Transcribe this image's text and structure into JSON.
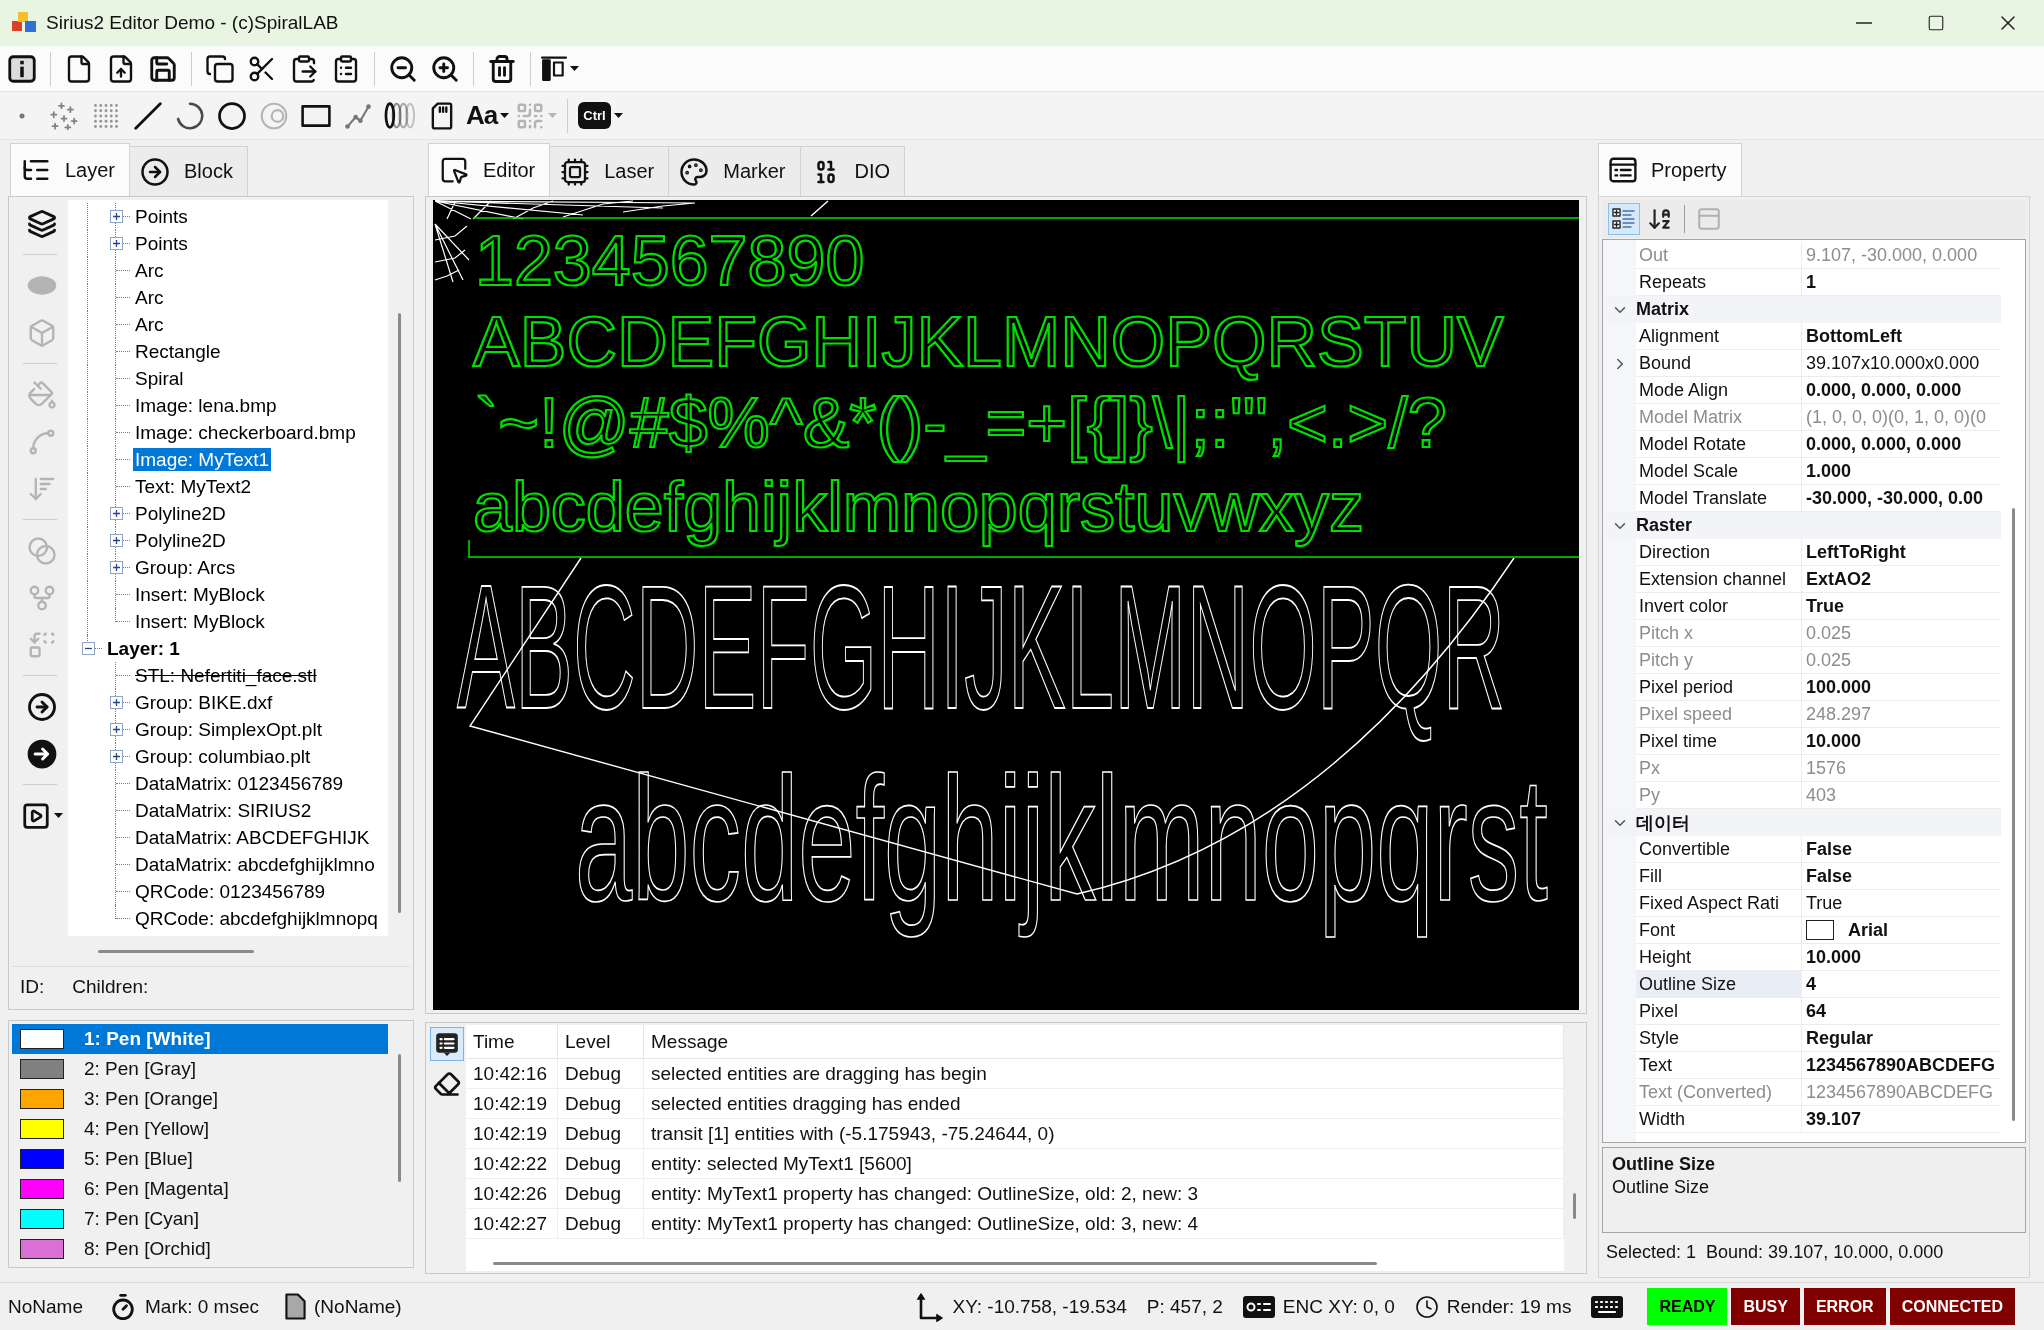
{
  "window": {
    "title": "Sirius2 Editor Demo - (c)SpiralLAB"
  },
  "main_toolbar": {
    "groups": [
      {
        "buttons": [
          {
            "kind": "info",
            "disabled": false,
            "menu": false
          }
        ]
      },
      {
        "buttons": [
          {
            "kind": "new",
            "disabled": false,
            "menu": false
          },
          {
            "kind": "open",
            "disabled": false,
            "menu": false
          },
          {
            "kind": "save",
            "disabled": false,
            "menu": false
          }
        ]
      },
      {
        "buttons": [
          {
            "kind": "copy",
            "disabled": false,
            "menu": false
          },
          {
            "kind": "cut",
            "disabled": false,
            "menu": false
          },
          {
            "kind": "paste",
            "disabled": false,
            "menu": false
          },
          {
            "kind": "clipboard",
            "disabled": false,
            "menu": false
          }
        ]
      },
      {
        "buttons": [
          {
            "kind": "zoomout",
            "disabled": false,
            "menu": false
          },
          {
            "kind": "zoomin",
            "disabled": false,
            "menu": false
          }
        ]
      },
      {
        "buttons": [
          {
            "kind": "delete",
            "disabled": false,
            "menu": false
          }
        ]
      },
      {
        "buttons": [
          {
            "kind": "align",
            "disabled": false,
            "menu": true
          }
        ]
      }
    ]
  },
  "draw_toolbar": {
    "groups": [
      {
        "buttons": [
          {
            "kind": "point",
            "disabled": false,
            "menu": false
          },
          {
            "kind": "points",
            "disabled": false,
            "menu": false
          },
          {
            "kind": "grid",
            "disabled": false,
            "menu": false
          },
          {
            "kind": "line",
            "disabled": false,
            "menu": false
          },
          {
            "kind": "arc",
            "disabled": false,
            "menu": false
          },
          {
            "kind": "circle",
            "disabled": false,
            "menu": false
          },
          {
            "kind": "trepan",
            "disabled": true,
            "menu": false
          },
          {
            "kind": "rectangle",
            "disabled": false,
            "menu": false
          },
          {
            "kind": "polyline",
            "disabled": false,
            "menu": false
          },
          {
            "kind": "spiral",
            "disabled": false,
            "menu": false
          },
          {
            "kind": "card",
            "disabled": false,
            "menu": false
          },
          {
            "kind": "text",
            "label": "Aa",
            "disabled": false,
            "menu": true
          },
          {
            "kind": "barcode",
            "disabled": true,
            "menu": true
          }
        ]
      },
      {
        "buttons": [
          {
            "kind": "key",
            "label": "Ctrl",
            "disabled": false,
            "menu": true
          }
        ]
      }
    ]
  },
  "left_tabs": [
    {
      "label": "Layer",
      "kind": "tree",
      "selected": true
    },
    {
      "label": "Block",
      "kind": "block",
      "selected": false
    }
  ],
  "side_tools": {
    "groups": [
      {
        "buttons": [
          {
            "kind": "layers",
            "disabled": false,
            "menu": false
          }
        ]
      },
      {
        "buttons": [
          {
            "kind": "mesh",
            "disabled": true,
            "menu": false
          },
          {
            "kind": "cube",
            "disabled": true,
            "menu": false
          }
        ]
      },
      {
        "buttons": [
          {
            "kind": "bucket",
            "disabled": true,
            "menu": false
          },
          {
            "kind": "path",
            "disabled": true,
            "menu": false
          },
          {
            "kind": "sort",
            "disabled": true,
            "menu": false
          }
        ]
      },
      {
        "buttons": [
          {
            "kind": "union",
            "disabled": true,
            "menu": false
          },
          {
            "kind": "split",
            "disabled": true,
            "menu": false
          },
          {
            "kind": "swap",
            "disabled": true,
            "menu": false
          }
        ]
      },
      {
        "buttons": [
          {
            "kind": "block",
            "disabled": false,
            "menu": false
          },
          {
            "kind": "insert",
            "disabled": false,
            "menu": false
          }
        ]
      },
      {
        "buttons": [
          {
            "kind": "script",
            "disabled": false,
            "menu": true
          }
        ]
      }
    ]
  },
  "layer_tree": {
    "scrolled_layer_children": [
      {
        "label": "Points",
        "kind": "node",
        "expanded": false,
        "selected": false,
        "disabled": false
      },
      {
        "label": "Points",
        "kind": "node",
        "expanded": false,
        "selected": false,
        "disabled": false
      },
      {
        "label": "Arc",
        "kind": "leaf",
        "selected": false,
        "disabled": false
      },
      {
        "label": "Arc",
        "kind": "leaf",
        "selected": false,
        "disabled": false
      },
      {
        "label": "Arc",
        "kind": "leaf",
        "selected": false,
        "disabled": false
      },
      {
        "label": "Rectangle",
        "kind": "leaf",
        "selected": false,
        "disabled": false
      },
      {
        "label": "Spiral",
        "kind": "leaf",
        "selected": false,
        "disabled": false
      },
      {
        "label": "Image: lena.bmp",
        "kind": "leaf",
        "selected": false,
        "disabled": false
      },
      {
        "label": "Image: checkerboard.bmp",
        "kind": "leaf",
        "selected": false,
        "disabled": false
      },
      {
        "label": "Image: MyText1",
        "kind": "leaf",
        "selected": true,
        "disabled": false
      },
      {
        "label": "Text: MyText2",
        "kind": "leaf",
        "selected": false,
        "disabled": false
      },
      {
        "label": "Polyline2D",
        "kind": "node",
        "expanded": false,
        "selected": false,
        "disabled": false
      },
      {
        "label": "Polyline2D",
        "kind": "node",
        "expanded": false,
        "selected": false,
        "disabled": false
      },
      {
        "label": "Group: Arcs",
        "kind": "node",
        "expanded": false,
        "selected": false,
        "disabled": false
      },
      {
        "label": "Insert: MyBlock",
        "kind": "leaf",
        "selected": false,
        "disabled": false
      },
      {
        "label": "Insert: MyBlock",
        "kind": "leaf",
        "selected": false,
        "disabled": false
      }
    ],
    "layers": [
      {
        "label": "Layer: 1",
        "kind": "layer",
        "expanded": true,
        "selected": false,
        "disabled": false,
        "children": [
          {
            "label": "STL: Nefertiti_face.stl",
            "kind": "leaf",
            "selected": false,
            "disabled": true
          },
          {
            "label": "Group: BIKE.dxf",
            "kind": "node",
            "expanded": false,
            "selected": false,
            "disabled": false
          },
          {
            "label": "Group: SimplexOpt.plt",
            "kind": "node",
            "expanded": false,
            "selected": false,
            "disabled": false
          },
          {
            "label": "Group: columbiao.plt",
            "kind": "node",
            "expanded": false,
            "selected": false,
            "disabled": false
          },
          {
            "label": "DataMatrix: 0123456789",
            "kind": "leaf",
            "selected": false,
            "disabled": false
          },
          {
            "label": "DataMatrix: SIRIUS2",
            "kind": "leaf",
            "selected": false,
            "disabled": false
          },
          {
            "label": "DataMatrix: ABCDEFGHIJK",
            "kind": "leaf",
            "selected": false,
            "disabled": false
          },
          {
            "label": "DataMatrix: abcdefghijklmno",
            "kind": "leaf",
            "selected": false,
            "disabled": false
          },
          {
            "label": "QRCode: 0123456789",
            "kind": "leaf",
            "selected": false,
            "disabled": false
          },
          {
            "label": "QRCode: abcdefghijklmnopq",
            "kind": "leaf",
            "selected": false,
            "disabled": false
          }
        ]
      }
    ]
  },
  "id_bar": {
    "id_label": "ID:",
    "children_label": "Children:"
  },
  "pens": [
    {
      "label": "1: Pen [White]",
      "color": "#ffffff",
      "selected": true
    },
    {
      "label": "2: Pen [Gray]",
      "color": "#808080",
      "selected": false
    },
    {
      "label": "3: Pen [Orange]",
      "color": "#ffa500",
      "selected": false
    },
    {
      "label": "4: Pen [Yellow]",
      "color": "#ffff00",
      "selected": false
    },
    {
      "label": "5: Pen [Blue]",
      "color": "#0000ff",
      "selected": false
    },
    {
      "label": "6: Pen [Magenta]",
      "color": "#ff00ff",
      "selected": false
    },
    {
      "label": "7: Pen [Cyan]",
      "color": "#00ffff",
      "selected": false
    },
    {
      "label": "8: Pen [Orchid]",
      "color": "#da70d6",
      "selected": false
    }
  ],
  "center_tabs": [
    {
      "label": "Editor",
      "kind": "editor",
      "selected": true
    },
    {
      "label": "Laser",
      "kind": "laser",
      "selected": false
    },
    {
      "label": "Marker",
      "kind": "marker",
      "selected": false
    },
    {
      "label": "DIO",
      "kind": "dio",
      "selected": false
    }
  ],
  "canvas": {
    "entities": [
      {
        "kind": "text",
        "selected": true,
        "lines": [
          "1234567890",
          "ABCDEFGHIJKLMNOPQRSTUV",
          "`~!@#$%^&*()-_=+[{]}\\|;:'\",<.>/?",
          "abcdefghijklmnopqrstuvwxyz"
        ]
      },
      {
        "kind": "text",
        "selected": false,
        "lines": [
          "ABCDEFGHIJKLMNOPQR",
          "abcdefghijklmnopqrst"
        ]
      }
    ]
  },
  "log": {
    "tools": [
      {
        "kind": "list",
        "selected": true
      },
      {
        "kind": "eraser",
        "selected": false
      }
    ],
    "columns": [
      "Time",
      "Level",
      "Message"
    ],
    "rows": [
      {
        "time": "10:42:16",
        "level": "Debug",
        "message": "selected entities are dragging has begin"
      },
      {
        "time": "10:42:19",
        "level": "Debug",
        "message": "selected entities dragging has ended"
      },
      {
        "time": "10:42:19",
        "level": "Debug",
        "message": "transit [1] entities with (-5.175943, -75.24644, 0)"
      },
      {
        "time": "10:42:22",
        "level": "Debug",
        "message": "entity: selected MyText1 [5600]"
      },
      {
        "time": "10:42:26",
        "level": "Debug",
        "message": "entity: MyText1 property has changed: OutlineSize, old: 2, new: 3"
      },
      {
        "time": "10:42:27",
        "level": "Debug",
        "message": "entity: MyText1 property has changed: OutlineSize, old: 3, new: 4"
      }
    ]
  },
  "property": {
    "tabs": [
      {
        "label": "Property",
        "kind": "property",
        "selected": true
      }
    ],
    "toolbar": {
      "groups": [
        {
          "buttons": [
            {
              "kind": "categorized",
              "selected": true,
              "disabled": false
            },
            {
              "kind": "alphabetical",
              "selected": false,
              "disabled": false
            }
          ]
        },
        {
          "buttons": [
            {
              "kind": "pages",
              "selected": false,
              "disabled": true
            }
          ]
        }
      ]
    },
    "scrolled_rows": [
      {
        "name": "Out",
        "value": "9.107, -30.000, 0.000",
        "kind": "value",
        "readonly": true,
        "modified": false,
        "selected": false
      },
      {
        "name": "Repeats",
        "value": "1",
        "kind": "value",
        "readonly": false,
        "modified": true,
        "selected": false
      }
    ],
    "categories": [
      {
        "label": "Matrix",
        "expanded": true,
        "rows": [
          {
            "name": "Alignment",
            "value": "BottomLeft",
            "kind": "value",
            "readonly": false,
            "modified": true,
            "selected": false
          },
          {
            "name": "Bound",
            "value": "39.107x10.000x0.000",
            "kind": "object",
            "expanded": false,
            "readonly": false,
            "modified": false,
            "selected": false
          },
          {
            "name": "Mode Align",
            "value": "0.000, 0.000, 0.000",
            "kind": "value",
            "readonly": false,
            "modified": true,
            "selected": false
          },
          {
            "name": "Model Matrix",
            "value": "(1, 0, 0, 0)(0, 1, 0, 0)(0",
            "kind": "value",
            "readonly": true,
            "modified": false,
            "selected": false
          },
          {
            "name": "Model Rotate",
            "value": "0.000, 0.000, 0.000",
            "kind": "value",
            "readonly": false,
            "modified": true,
            "selected": false
          },
          {
            "name": "Model Scale",
            "value": "1.000",
            "kind": "value",
            "readonly": false,
            "modified": true,
            "selected": false
          },
          {
            "name": "Model Translate",
            "value": "-30.000, -30.000, 0.00",
            "kind": "value",
            "readonly": false,
            "modified": true,
            "selected": false
          }
        ]
      },
      {
        "label": "Raster",
        "expanded": true,
        "rows": [
          {
            "name": "Direction",
            "value": "LeftToRight",
            "kind": "value",
            "readonly": false,
            "modified": true,
            "selected": false
          },
          {
            "name": "Extension channel",
            "value": "ExtAO2",
            "kind": "value",
            "readonly": false,
            "modified": true,
            "selected": false
          },
          {
            "name": "Invert color",
            "value": "True",
            "kind": "value",
            "readonly": false,
            "modified": true,
            "selected": false
          },
          {
            "name": "Pitch x",
            "value": "0.025",
            "kind": "value",
            "readonly": true,
            "modified": false,
            "selected": false
          },
          {
            "name": "Pitch y",
            "value": "0.025",
            "kind": "value",
            "readonly": true,
            "modified": false,
            "selected": false
          },
          {
            "name": "Pixel period",
            "value": "100.000",
            "kind": "value",
            "readonly": false,
            "modified": true,
            "selected": false
          },
          {
            "name": "Pixel speed",
            "value": "248.297",
            "kind": "value",
            "readonly": true,
            "modified": false,
            "selected": false
          },
          {
            "name": "Pixel time",
            "value": "10.000",
            "kind": "value",
            "readonly": false,
            "modified": true,
            "selected": false
          },
          {
            "name": "Px",
            "value": "1576",
            "kind": "value",
            "readonly": true,
            "modified": false,
            "selected": false
          },
          {
            "name": "Py",
            "value": "403",
            "kind": "value",
            "readonly": true,
            "modified": false,
            "selected": false
          }
        ]
      },
      {
        "label": "데이터",
        "expanded": true,
        "rows": [
          {
            "name": "Convertible",
            "value": "False",
            "kind": "value",
            "readonly": false,
            "modified": true,
            "selected": false
          },
          {
            "name": "Fill",
            "value": "False",
            "kind": "value",
            "readonly": false,
            "modified": true,
            "selected": false
          },
          {
            "name": "Fixed Aspect Rati",
            "value": "True",
            "kind": "value",
            "readonly": false,
            "modified": false,
            "selected": false
          },
          {
            "name": "Font",
            "value": "Arial",
            "kind": "font",
            "readonly": false,
            "modified": true,
            "selected": false
          },
          {
            "name": "Height",
            "value": "10.000",
            "kind": "value",
            "readonly": false,
            "modified": true,
            "selected": false
          },
          {
            "name": "Outline Size",
            "value": "4",
            "kind": "value",
            "readonly": false,
            "modified": true,
            "selected": true
          },
          {
            "name": "Pixel",
            "value": "64",
            "kind": "value",
            "readonly": false,
            "modified": true,
            "selected": false
          },
          {
            "name": "Style",
            "value": "Regular",
            "kind": "value",
            "readonly": false,
            "modified": true,
            "selected": false
          },
          {
            "name": "Text",
            "value": "1234567890ABCDEFG",
            "kind": "value",
            "readonly": false,
            "modified": true,
            "selected": false
          },
          {
            "name": "Text (Converted)",
            "value": "1234567890ABCDEFG",
            "kind": "value",
            "readonly": true,
            "modified": false,
            "selected": false
          },
          {
            "name": "Width",
            "value": "39.107",
            "kind": "value",
            "readonly": false,
            "modified": true,
            "selected": false
          }
        ]
      }
    ],
    "description": {
      "title": "Outline Size",
      "text": "Outline Size"
    },
    "selection": [
      "Selected: 1",
      "Bound: 39.107, 10.000, 0.000"
    ]
  },
  "status_bar": {
    "left": [
      {
        "kind": "text",
        "text": "NoName"
      },
      {
        "kind": "timer",
        "text": "Mark: 0 msec"
      },
      {
        "kind": "file",
        "text": "(NoName)"
      }
    ],
    "right": [
      {
        "kind": "axes",
        "text": "XY: -10.758, -19.534"
      },
      {
        "kind": "text",
        "text": "P: 457, 2"
      },
      {
        "kind": "encoder",
        "text": "ENC XY: 0, 0"
      },
      {
        "kind": "clock",
        "text": "Render: 19 ms"
      },
      {
        "kind": "keyboard"
      }
    ],
    "indicators": [
      {
        "label": "READY",
        "on": true
      },
      {
        "label": "BUSY",
        "on": false
      },
      {
        "label": "ERROR",
        "on": false
      },
      {
        "label": "CONNECTED",
        "on": false
      }
    ]
  }
}
